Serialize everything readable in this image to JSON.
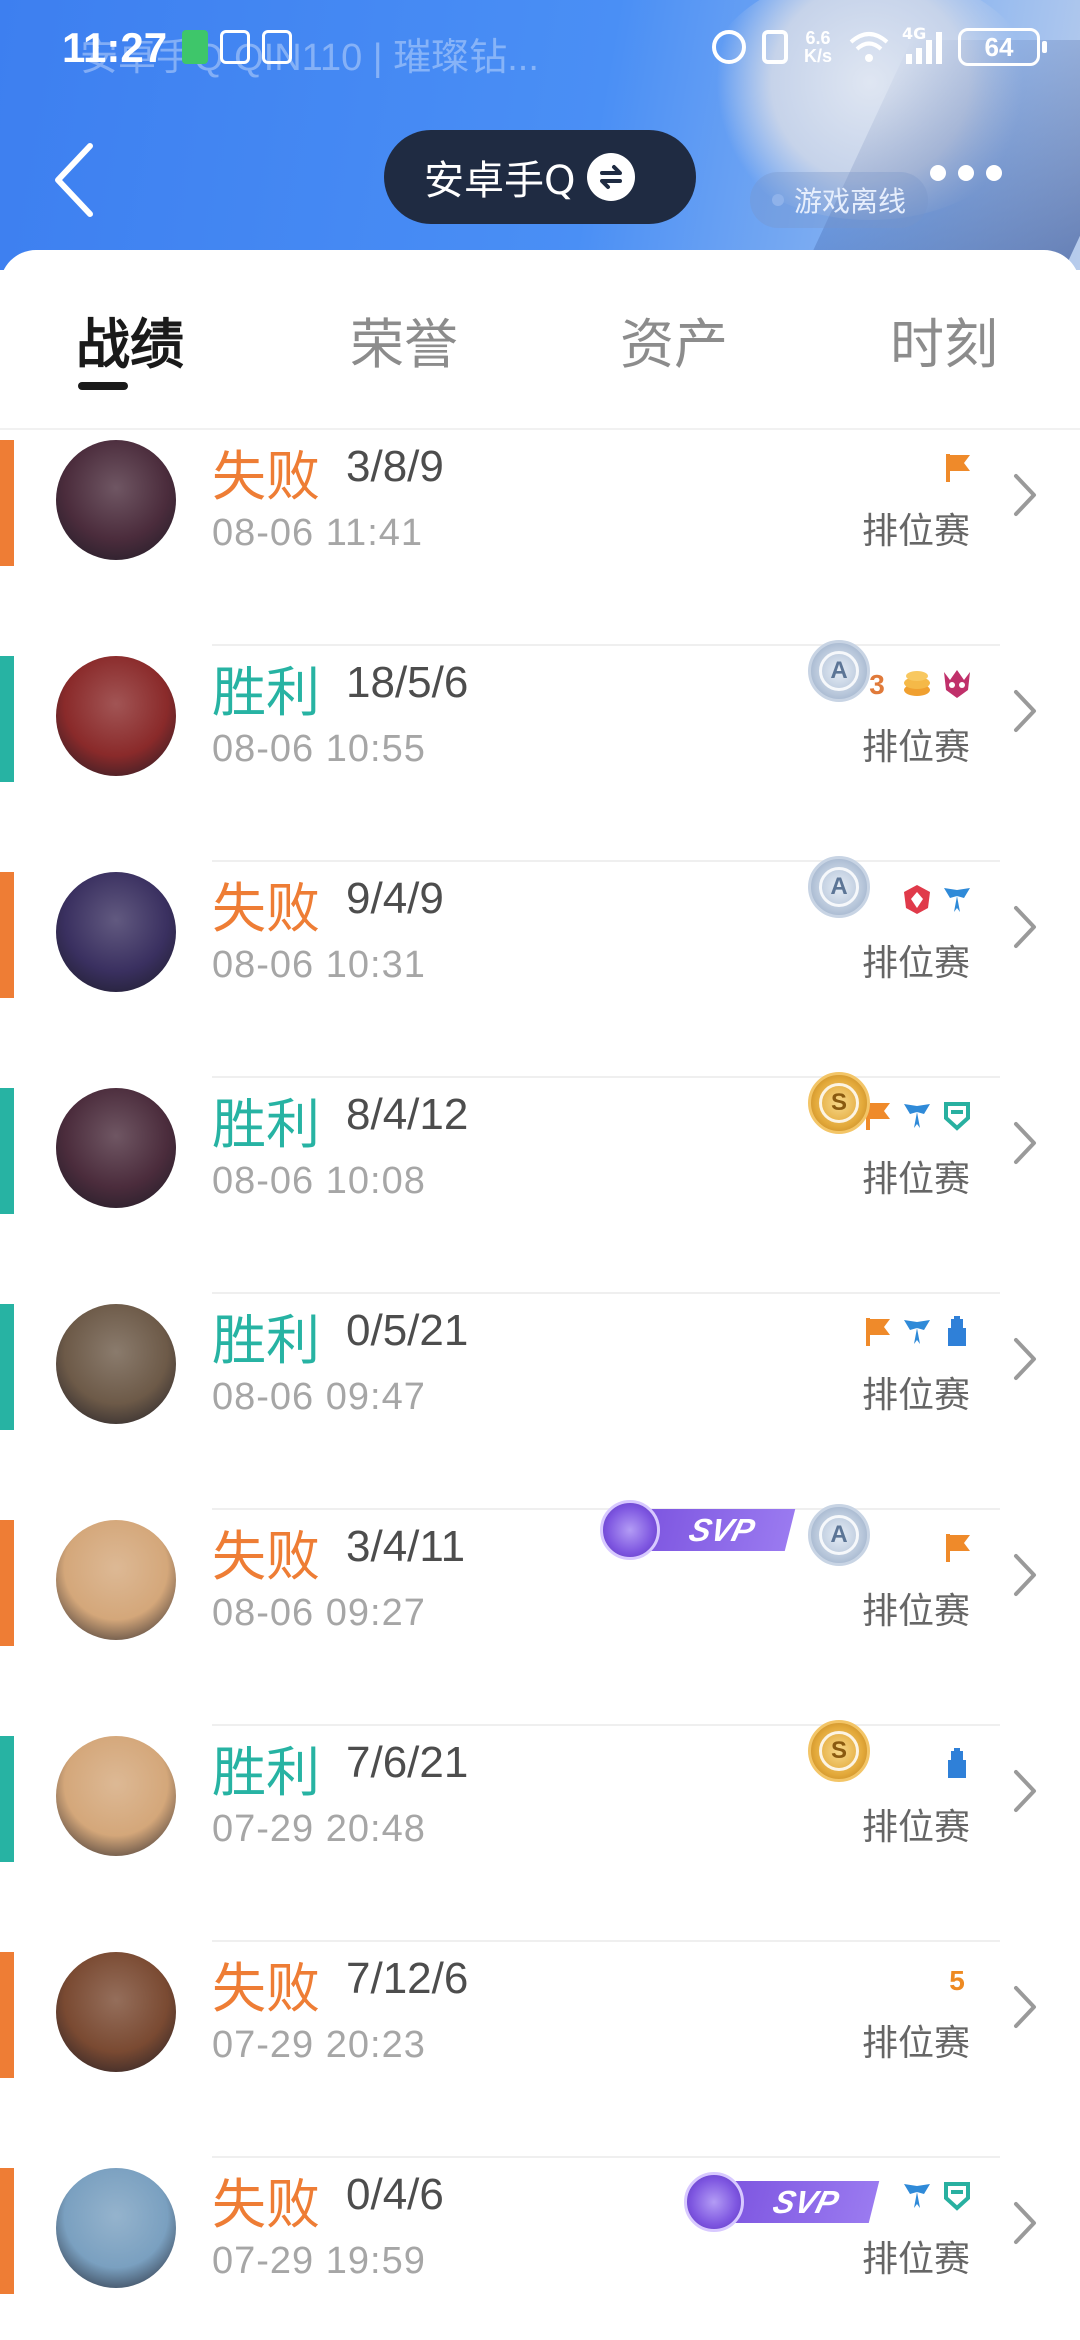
{
  "status_bar": {
    "time": "11:27",
    "ghost_text": "安卓手Q QIN110 | 璀璨钻...",
    "speed": "6.6\nK/s",
    "network": "4G",
    "battery": "64"
  },
  "header": {
    "account_name": "安卓手Q",
    "offline_status": "游戏离线"
  },
  "tabs": [
    {
      "label": "战绩",
      "active": true
    },
    {
      "label": "荣誉",
      "active": false
    },
    {
      "label": "资产",
      "active": false
    },
    {
      "label": "时刻",
      "active": false
    }
  ],
  "colors": {
    "lose": "#ee7d35",
    "win": "#27b3a3",
    "header_blue": "#3d7ff0"
  },
  "matches": [
    {
      "result": "失败",
      "outcome": "lose",
      "kda": "3/8/9",
      "time": "08-06 11:41",
      "mode": "排位赛",
      "hero_tone": "#4b2c3c",
      "medal": null,
      "svp": false,
      "tags": [
        "orange-flag"
      ]
    },
    {
      "result": "胜利",
      "outcome": "win",
      "kda": "18/5/6",
      "time": "08-06 10:55",
      "mode": "排位赛",
      "hero_tone": "#8a2a2a",
      "medal": "A",
      "svp": false,
      "tags": [
        "triple-kill",
        "coins",
        "demon"
      ]
    },
    {
      "result": "失败",
      "outcome": "lose",
      "kda": "9/4/9",
      "time": "08-06 10:31",
      "mode": "排位赛",
      "hero_tone": "#3a3060",
      "medal": "A",
      "svp": false,
      "tags": [
        "red-emblem",
        "blue-wings"
      ]
    },
    {
      "result": "胜利",
      "outcome": "win",
      "kda": "8/4/12",
      "time": "08-06 10:08",
      "mode": "排位赛",
      "hero_tone": "#4b2c3c",
      "medal": "S",
      "svp": false,
      "tags": [
        "orange-flag",
        "blue-wings",
        "teal-shield"
      ]
    },
    {
      "result": "胜利",
      "outcome": "win",
      "kda": "0/5/21",
      "time": "08-06 09:47",
      "mode": "排位赛",
      "hero_tone": "#6d5a48",
      "medal": null,
      "svp": false,
      "tags": [
        "orange-flag",
        "blue-wings",
        "blue-tower"
      ]
    },
    {
      "result": "失败",
      "outcome": "lose",
      "kda": "3/4/11",
      "time": "08-06 09:27",
      "mode": "排位赛",
      "hero_tone": "#d4a77a",
      "medal": "A",
      "svp": true,
      "svp_text": "SVP",
      "tags": [
        "orange-flag"
      ]
    },
    {
      "result": "胜利",
      "outcome": "win",
      "kda": "7/6/21",
      "time": "07-29 20:48",
      "mode": "排位赛",
      "hero_tone": "#d4a77a",
      "medal": "S",
      "svp": false,
      "tags": [
        "blue-tower"
      ]
    },
    {
      "result": "失败",
      "outcome": "lose",
      "kda": "7/12/6",
      "time": "07-29 20:23",
      "mode": "排位赛",
      "hero_tone": "#7a4a32",
      "medal": null,
      "svp": false,
      "tags": [
        "penta-kill"
      ]
    },
    {
      "result": "失败",
      "outcome": "lose",
      "kda": "0/4/6",
      "time": "07-29 19:59",
      "mode": "排位赛",
      "hero_tone": "#7aa0c0",
      "medal": null,
      "svp": true,
      "svp_text": "SVP",
      "tags": [
        "blue-wings",
        "teal-shield"
      ]
    }
  ]
}
